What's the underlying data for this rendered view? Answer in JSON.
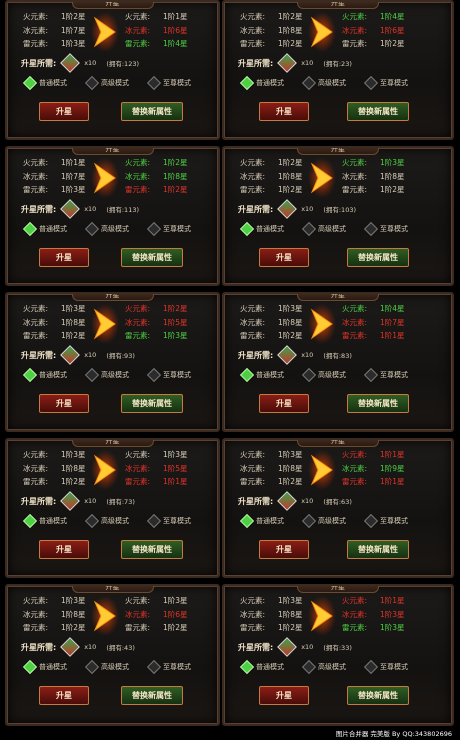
{
  "labels": {
    "fire": "火元素:",
    "ice": "冰元素:",
    "thunder": "雷元素:",
    "cost_label": "升星所需:",
    "upgrade": "升星",
    "replace": "替换新属性",
    "top_tab": "升星"
  },
  "modes": [
    "普通模式",
    "高级模式",
    "至尊模式"
  ],
  "panels": [
    {
      "left": [
        [
          "1阶2星"
        ],
        [
          "1阶7星"
        ],
        [
          "1阶3星"
        ]
      ],
      "right": [
        [
          "1阶1星",
          "d",
          "0",
          ""
        ],
        [
          "1阶6星",
          "r",
          "-1",
          "down"
        ],
        [
          "1阶4星",
          "g",
          "+1",
          "up"
        ]
      ],
      "qty": "x10",
      "own": "(拥有:123)"
    },
    {
      "left": [
        [
          "1阶2星"
        ],
        [
          "1阶8星"
        ],
        [
          "1阶2星"
        ]
      ],
      "right": [
        [
          "1阶4星",
          "g",
          "+1",
          "up"
        ],
        [
          "1阶6星",
          "r",
          "-2",
          "down"
        ],
        [
          "1阶2星",
          "d",
          "0",
          ""
        ]
      ],
      "qty": "x10",
      "own": "(拥有:23)"
    },
    {
      "left": [
        [
          "1阶1星"
        ],
        [
          "1阶7星"
        ],
        [
          "1阶3星"
        ]
      ],
      "right": [
        [
          "1阶2星",
          "g",
          "+1",
          "up"
        ],
        [
          "1阶8星",
          "g",
          "+1",
          "up"
        ],
        [
          "1阶2星",
          "r",
          "-1",
          "down"
        ]
      ],
      "qty": "x10",
      "own": "(拥有:113)"
    },
    {
      "left": [
        [
          "1阶2星"
        ],
        [
          "1阶8星"
        ],
        [
          "1阶2星"
        ]
      ],
      "right": [
        [
          "1阶3星",
          "g",
          "+1",
          "up"
        ],
        [
          "1阶8星",
          "d",
          "0",
          ""
        ],
        [
          "1阶2星",
          "d",
          "0",
          ""
        ]
      ],
      "qty": "x10",
      "own": "(拥有:103)"
    },
    {
      "left": [
        [
          "1阶3星"
        ],
        [
          "1阶8星"
        ],
        [
          "1阶2星"
        ]
      ],
      "right": [
        [
          "1阶2星",
          "r",
          "-1",
          "down"
        ],
        [
          "1阶5星",
          "r",
          "-3",
          "down"
        ],
        [
          "1阶3星",
          "g",
          "+1",
          "up"
        ]
      ],
      "qty": "x10",
      "own": "(拥有:93)"
    },
    {
      "left": [
        [
          "1阶3星"
        ],
        [
          "1阶8星"
        ],
        [
          "1阶2星"
        ]
      ],
      "right": [
        [
          "1阶4星",
          "g",
          "+1",
          "up"
        ],
        [
          "1阶7星",
          "r",
          "-1",
          "down"
        ],
        [
          "1阶1星",
          "r",
          "-1",
          "down"
        ]
      ],
      "qty": "x10",
      "own": "(拥有:83)"
    },
    {
      "left": [
        [
          "1阶3星"
        ],
        [
          "1阶8星"
        ],
        [
          "1阶2星"
        ]
      ],
      "right": [
        [
          "1阶3星",
          "d",
          "0",
          ""
        ],
        [
          "1阶5星",
          "r",
          "-3",
          "down"
        ],
        [
          "1阶1星",
          "r",
          "-1",
          "down"
        ]
      ],
      "qty": "x10",
      "own": "(拥有:73)"
    },
    {
      "left": [
        [
          "1阶3星"
        ],
        [
          "1阶8星"
        ],
        [
          "1阶2星"
        ]
      ],
      "right": [
        [
          "1阶1星",
          "r",
          "-2",
          "down"
        ],
        [
          "1阶9星",
          "g",
          "+1",
          "up"
        ],
        [
          "1阶1星",
          "r",
          "-1",
          "down"
        ]
      ],
      "qty": "x10",
      "own": "(拥有:63)"
    },
    {
      "left": [
        [
          "1阶3星"
        ],
        [
          "1阶8星"
        ],
        [
          "1阶2星"
        ]
      ],
      "right": [
        [
          "1阶3星",
          "d",
          "0",
          ""
        ],
        [
          "1阶6星",
          "r",
          "-2",
          "down"
        ],
        [
          "1阶2星",
          "d",
          "0",
          ""
        ]
      ],
      "qty": "x10",
      "own": "(拥有:43)"
    },
    {
      "left": [
        [
          "1阶3星"
        ],
        [
          "1阶8星"
        ],
        [
          "1阶2星"
        ]
      ],
      "right": [
        [
          "1阶1星",
          "r",
          "-2",
          "down"
        ],
        [
          "1阶3星",
          "r",
          "-5",
          "down"
        ],
        [
          "1阶3星",
          "g",
          "+1",
          "up"
        ]
      ],
      "qty": "x10",
      "own": "(拥有:33)"
    }
  ],
  "footer": "图片合并器  完美版 By QQ:343802696",
  "colors": {
    "green": "#4ed044",
    "red": "#e0342a",
    "neutral": "#d8cdb9"
  }
}
